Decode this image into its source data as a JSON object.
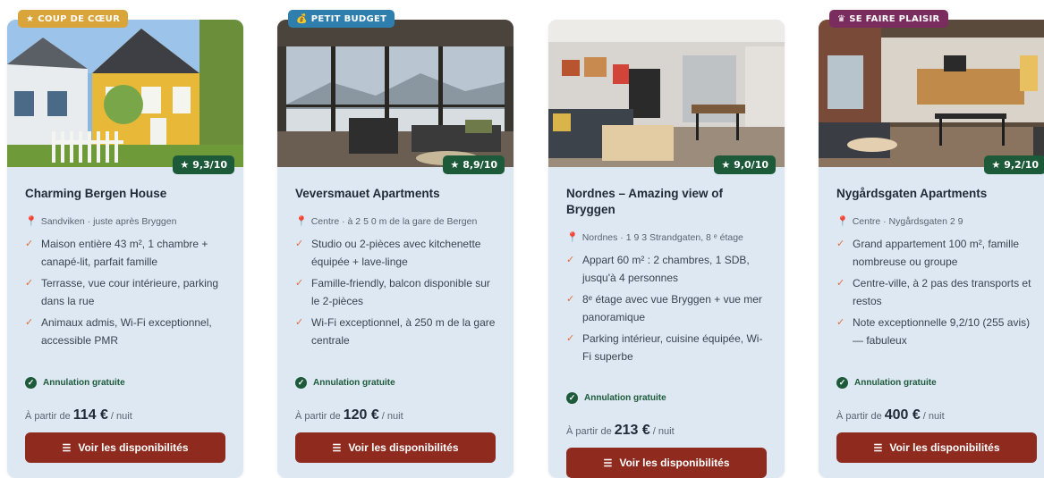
{
  "cards": [
    {
      "badge": "COUP DE CŒUR",
      "badge_icon": "star-icon",
      "badge_color": "#d9a43a",
      "rating": "9,3/10",
      "title": "Charming Bergen House",
      "location": "Sandviken · juste après Bryggen",
      "features": [
        "Maison entière 43 m², 1 chambre + canapé-lit, parfait famille",
        "Terrasse, vue cour intérieure, parking dans la rue",
        "Animaux admis, Wi-Fi exceptionnel, accessible PMR"
      ],
      "cancel": "Annulation gratuite",
      "price_prefix": "À partir de",
      "price": "114 €",
      "price_suffix": "/ nuit",
      "cta": "Voir les disponibilités"
    },
    {
      "badge": "PETIT BUDGET",
      "badge_icon": "money-bag-icon",
      "badge_color": "#2f7fae",
      "rating": "8,9/10",
      "title": "Veversmauet Apartments",
      "location": "Centre · à 2 5 0 m de la gare de Bergen",
      "features": [
        "Studio ou 2-pièces avec kitchenette équipée + lave-linge",
        "Famille-friendly, balcon disponible sur le 2-pièces",
        "Wi-Fi exceptionnel, à 250 m de la gare centrale"
      ],
      "cancel": "Annulation gratuite",
      "price_prefix": "À partir de",
      "price": "120 €",
      "price_suffix": "/ nuit",
      "cta": "Voir les disponibilités"
    },
    {
      "badge": "",
      "badge_icon": "",
      "badge_color": "",
      "rating": "9,0/10",
      "title": "Nordnes – Amazing view of Bryggen",
      "location": "Nordnes · 1 9 3 Strandgaten, 8 ᵉ étage",
      "features": [
        "Appart 60 m² : 2 chambres, 1 SDB, jusqu'à 4 personnes",
        "8ᵉ étage avec vue Bryggen + vue mer panoramique",
        "Parking intérieur, cuisine équipée, Wi-Fi superbe"
      ],
      "cancel": "Annulation gratuite",
      "price_prefix": "À partir de",
      "price": "213 €",
      "price_suffix": "/ nuit",
      "cta": "Voir les disponibilités"
    },
    {
      "badge": "SE FAIRE PLAISIR",
      "badge_icon": "crown-icon",
      "badge_color": "#7a2c5e",
      "rating": "9,2/10",
      "title": "Nygårdsgaten Apartments",
      "location": "Centre · Nygårdsgaten 2 9",
      "features": [
        "Grand appartement 100 m², famille nombreuse ou groupe",
        "Centre-ville, à 2 pas des transports et restos",
        "Note exceptionnelle 9,2/10 (255 avis) — fabuleux"
      ],
      "cancel": "Annulation gratuite",
      "price_prefix": "À partir de",
      "price": "400 €",
      "price_suffix": "/ nuit",
      "cta": "Voir les disponibilités"
    }
  ]
}
